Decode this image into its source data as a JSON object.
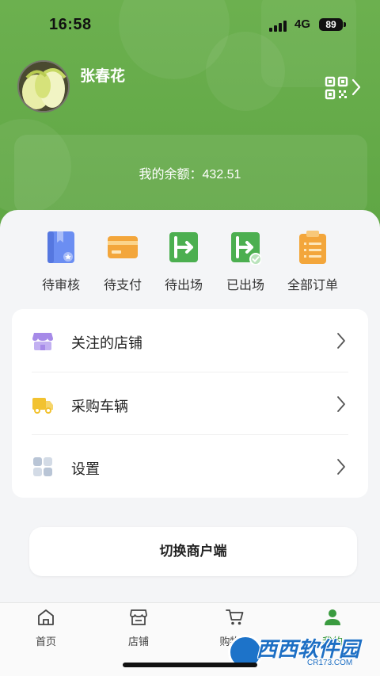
{
  "status_bar": {
    "time": "16:58",
    "network": "4G",
    "battery": "89"
  },
  "profile": {
    "name": "张春花",
    "avatar_icon": "cabbage-photo",
    "qr_icon": "qr-code-icon"
  },
  "balance": {
    "text": "我的余额：432.51"
  },
  "orders": [
    {
      "label": "待审核",
      "icon": "pending-review-icon",
      "color": "#6b8ef2"
    },
    {
      "label": "待支付",
      "icon": "pending-payment-icon",
      "color": "#f3a63b"
    },
    {
      "label": "待出场",
      "icon": "pending-exit-icon",
      "color": "#4caf50"
    },
    {
      "label": "已出场",
      "icon": "exited-icon",
      "color": "#4caf50"
    },
    {
      "label": "全部订单",
      "icon": "all-orders-icon",
      "color": "#f3a63b"
    }
  ],
  "menu": [
    {
      "label": "关注的店铺",
      "icon": "store-icon",
      "color": "#a68ae8"
    },
    {
      "label": "采购车辆",
      "icon": "truck-icon",
      "color": "#f2c230"
    },
    {
      "label": "设置",
      "icon": "settings-grid-icon",
      "color": "#b9c5d6"
    }
  ],
  "switch_button": {
    "label": "切换商户端"
  },
  "tabbar": [
    {
      "label": "首页",
      "icon": "home-icon",
      "active": false
    },
    {
      "label": "店铺",
      "icon": "shop-icon",
      "active": false
    },
    {
      "label": "购物车",
      "icon": "cart-icon",
      "active": false
    },
    {
      "label": "我的",
      "icon": "user-icon",
      "active": true
    }
  ],
  "watermark": {
    "text": "西西软件园",
    "sub": "CR173.COM"
  },
  "colors": {
    "brand_green": "#5fa644",
    "active_tab": "#3a9b3f"
  }
}
